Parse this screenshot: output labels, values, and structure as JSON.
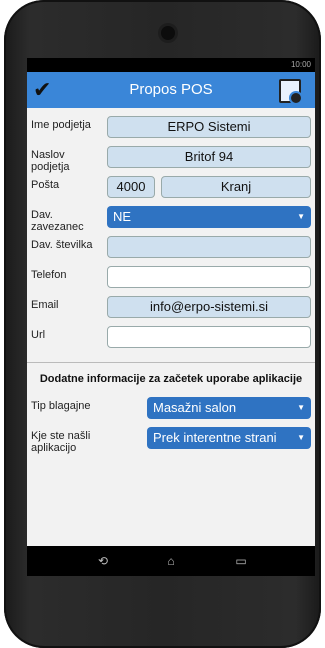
{
  "status": {
    "time": "10:00"
  },
  "app": {
    "title": "Propos POS"
  },
  "fields": {
    "company_label": "Ime podjetja",
    "company_value": "ERPO Sistemi",
    "address_label": "Naslov podjetja",
    "address_value": "Britof 94",
    "post_label": "Pošta",
    "post_code": "4000",
    "post_city": "Kranj",
    "taxpayer_label": "Dav. zavezanec",
    "taxpayer_value": "NE",
    "tax_number_label": "Dav. številka",
    "tax_number_value": "",
    "phone_label": "Telefon",
    "phone_value": "",
    "email_label": "Email",
    "email_value": "info@erpo-sistemi.si",
    "url_label": "Url",
    "url_value": ""
  },
  "extra": {
    "section_title": "Dodatne informacije za začetek uporabe aplikacije",
    "till_type_label": "Tip blagajne",
    "till_type_value": "Masažni salon",
    "found_label": "Kje ste našli aplikacijo",
    "found_value": "Prek interentne strani"
  },
  "colors": {
    "appbar": "#3a86d8",
    "select": "#2f73c2",
    "field": "#cfe0ef"
  }
}
